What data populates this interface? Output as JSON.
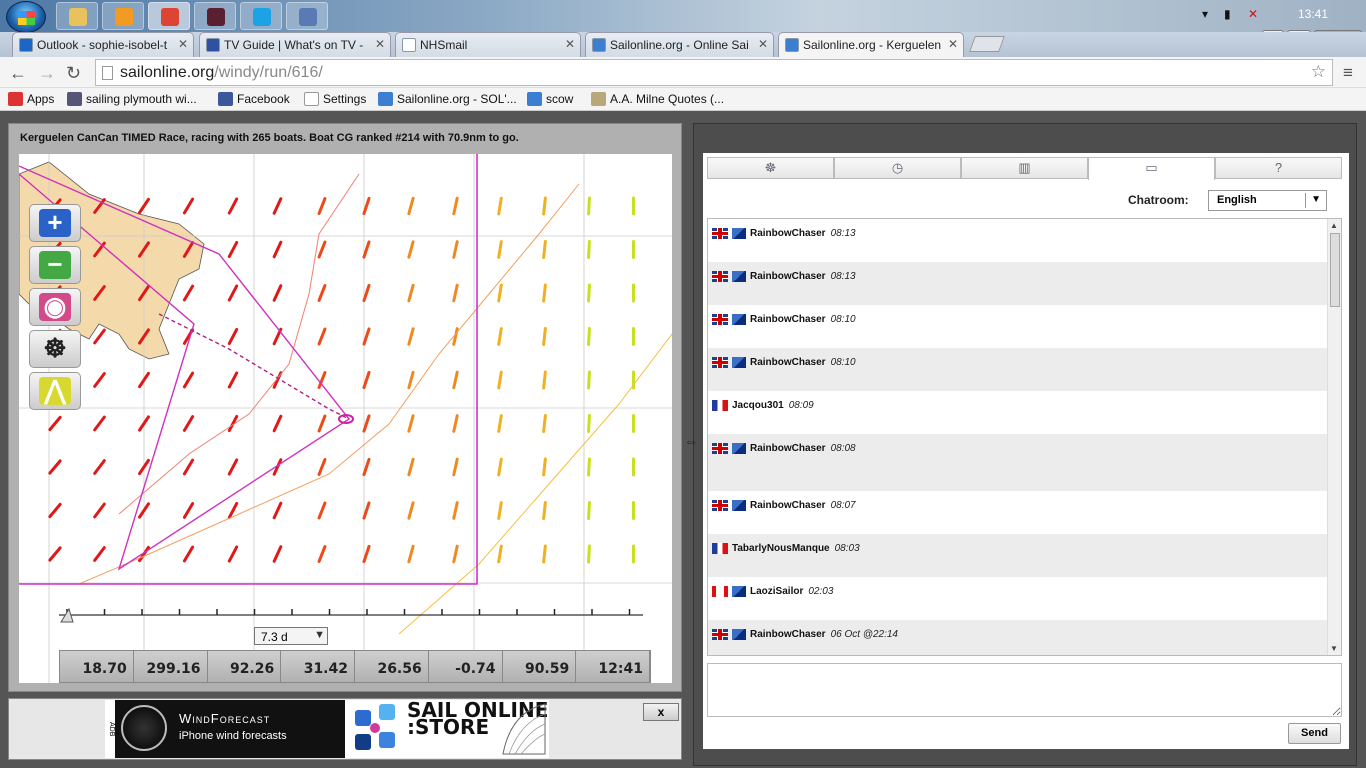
{
  "taskbar": {
    "clock": "13:41",
    "pinned": [
      {
        "name": "explorer-icon",
        "color": "#e8c25c"
      },
      {
        "name": "media-player-icon",
        "color": "#f29a22"
      },
      {
        "name": "chrome-icon",
        "color": "#dd4433"
      },
      {
        "name": "app-icon",
        "color": "#5a2030"
      },
      {
        "name": "skype-icon",
        "color": "#1ca3e6"
      },
      {
        "name": "globe-app-icon",
        "color": "#5a7ab5"
      }
    ]
  },
  "window_controls": {
    "minimize": "—",
    "maximize": "❐",
    "close": "✕"
  },
  "tabs": [
    {
      "label": "Outlook - sophie-isobel-t",
      "icon": "outlook-icon",
      "color": "#1e66c3",
      "active": false
    },
    {
      "label": "TV Guide | What's on TV -",
      "icon": "tvguide-icon",
      "color": "#3050a0",
      "active": false
    },
    {
      "label": "NHSmail",
      "icon": "page-icon",
      "color": "#ffffff",
      "active": false
    },
    {
      "label": "Sailonline.org - Online Sai",
      "icon": "sailonline-icon",
      "color": "#3c7fd0",
      "active": false
    },
    {
      "label": "Sailonline.org - Kerguelen",
      "icon": "sailonline-icon",
      "color": "#3c7fd0",
      "active": true
    }
  ],
  "tab_close": "✕",
  "address": {
    "host": "sailonline.org",
    "path": "/windy/run/616/"
  },
  "nav": {
    "back": "←",
    "forward": "→",
    "reload": "↻",
    "star": "☆",
    "menu": "≡"
  },
  "bookmarks": [
    {
      "label": "Apps",
      "icon": "apps-icon",
      "color": "#d33"
    },
    {
      "label": "sailing plymouth wi...",
      "icon": "globe-icon",
      "color": "#557"
    },
    {
      "label": "Facebook",
      "icon": "facebook-icon",
      "color": "#3b5998"
    },
    {
      "label": "Settings",
      "icon": "page-icon",
      "color": "#ffffff"
    },
    {
      "label": "Sailonline.org - SOL'...",
      "icon": "sailonline-icon",
      "color": "#3c7fd0"
    },
    {
      "label": "scow",
      "icon": "sailonline-icon",
      "color": "#3c7fd0"
    },
    {
      "label": "A.A. Milne Quotes (...",
      "icon": "goodreads-icon",
      "color": "#b8a77a"
    }
  ],
  "race": {
    "status": "Kerguelen CanCan TIMED Race, racing with 265 boats. Boat CG ranked #214 with 70.9nm to go."
  },
  "map_controls": [
    {
      "name": "zoom-in-button",
      "glyph": "+",
      "color": "#2a62c8"
    },
    {
      "name": "zoom-out-button",
      "glyph": "−",
      "color": "#44a844"
    },
    {
      "name": "center-boat-button",
      "glyph": "◉",
      "color": "#d24a8a"
    },
    {
      "name": "helm-button",
      "glyph": "☸",
      "color": "#333333"
    },
    {
      "name": "compass-tool-button",
      "glyph": "⋀",
      "color": "#d8d830"
    }
  ],
  "timeline": {
    "range_label": "7.3 d",
    "dropdown": "▼"
  },
  "stats": [
    "18.70",
    "299.16",
    "92.26",
    "31.42",
    "26.56",
    "-0.74",
    "90.59",
    "12:41"
  ],
  "ads": {
    "wind_title": "WindForecast",
    "wind_sub": "iPhone wind forecasts",
    "adb": "ADB",
    "store_text": "SAIL ONLINE :STORE",
    "close": "x"
  },
  "panel_tabs": [
    {
      "name": "tab-helm",
      "glyph": "☸",
      "active": false
    },
    {
      "name": "tab-clock",
      "glyph": "◷",
      "active": false
    },
    {
      "name": "tab-ranking",
      "glyph": "▥",
      "active": false
    },
    {
      "name": "tab-chat",
      "glyph": "▭",
      "active": true
    },
    {
      "name": "tab-help",
      "glyph": "?",
      "active": false
    }
  ],
  "chat": {
    "label": "Chatroom:",
    "room": "English",
    "send": "Send",
    "messages": [
      {
        "flag": "uk",
        "boat": true,
        "user": "RainbowChaser",
        "time": "08:13"
      },
      {
        "flag": "uk",
        "boat": true,
        "user": "RainbowChaser",
        "time": "08:13"
      },
      {
        "flag": "uk",
        "boat": true,
        "user": "RainbowChaser",
        "time": "08:10"
      },
      {
        "flag": "uk",
        "boat": true,
        "user": "RainbowChaser",
        "time": "08:10"
      },
      {
        "flag": "fr",
        "boat": false,
        "user": "Jacqou301",
        "time": "08:09"
      },
      {
        "flag": "uk",
        "boat": true,
        "user": "RainbowChaser",
        "time": "08:08"
      },
      {
        "flag": "uk",
        "boat": true,
        "user": "RainbowChaser",
        "time": "08:07"
      },
      {
        "flag": "fr",
        "boat": false,
        "user": "TabarlyNousManque",
        "time": "08:03"
      },
      {
        "flag": "ca",
        "boat": true,
        "user": "LaoziSailor",
        "time": "02:03"
      },
      {
        "flag": "uk",
        "boat": true,
        "user": "RainbowChaser",
        "time": "06 Oct @22:14"
      }
    ]
  }
}
